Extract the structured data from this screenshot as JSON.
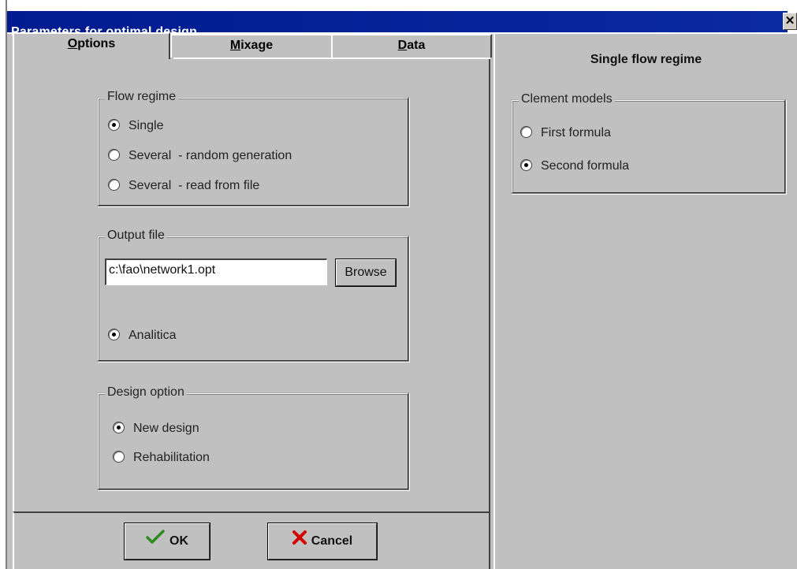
{
  "window": {
    "title": "Parameters for optimal design",
    "close_glyph": "✕"
  },
  "tabs": [
    {
      "label_first": "O",
      "label_rest": "ptions",
      "active": true
    },
    {
      "label_first": "M",
      "label_rest": "ixage",
      "active": false
    },
    {
      "label_first": "D",
      "label_rest": "ata",
      "active": false
    }
  ],
  "flow_regime": {
    "legend": "Flow regime",
    "options": [
      {
        "label": "Single",
        "selected": true
      },
      {
        "label": "Several  - random generation",
        "selected": false
      },
      {
        "label": "Several  - read from file",
        "selected": false
      }
    ]
  },
  "output_file": {
    "legend": "Output file",
    "path_value": "c:\\fao\\network1.opt",
    "browse_label": "Browse",
    "option_label": "Analitica",
    "option_selected": true
  },
  "design_option": {
    "legend": "Design option",
    "options": [
      {
        "label": "New design",
        "selected": true
      },
      {
        "label": "Rehabilitation",
        "selected": false
      }
    ]
  },
  "buttons": {
    "ok_label": "OK",
    "cancel_label": "Cancel",
    "ok_icon": "checkmark-icon",
    "cancel_icon": "red-x-icon",
    "ok_icon_color": "#2e8b1e",
    "cancel_icon_color": "#d40000"
  },
  "right_panel": {
    "heading": "Single flow regime",
    "group_legend": "Clement models",
    "options": [
      {
        "label": "First formula",
        "selected": false
      },
      {
        "label": "Second formula",
        "selected": true
      }
    ]
  },
  "colors": {
    "title_bar": "#001b8f",
    "face": "#c0c0c0"
  }
}
